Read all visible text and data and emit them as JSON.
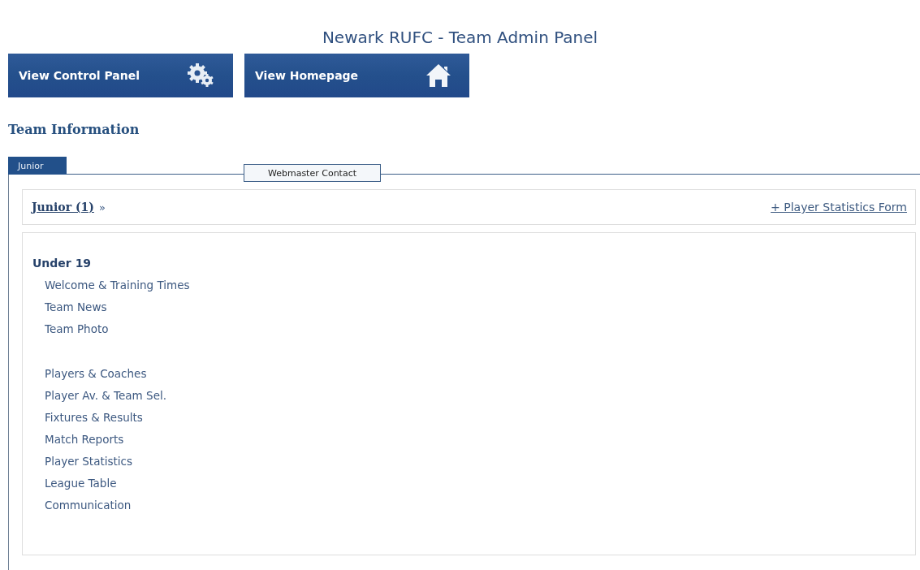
{
  "title": "Newark RUFC - Team Admin Panel",
  "buttons": [
    {
      "label": "View Control Panel",
      "kind": "settings"
    },
    {
      "label": "View Homepage",
      "kind": "home"
    }
  ],
  "section_heading": "Team Information",
  "tabs": [
    {
      "label": "Junior",
      "selected": true
    },
    {
      "label": "Webmaster Contact",
      "selected": false
    }
  ],
  "breadcrumb": {
    "link": "Junior (1)",
    "separator": "»"
  },
  "action_link": "+ Player Statistics Form",
  "team": {
    "name": "Under 19",
    "groups": [
      {
        "items": [
          "Welcome & Training Times",
          "Team News",
          "Team Photo"
        ]
      },
      {
        "items": [
          "Players & Coaches",
          "Player Av. & Team Sel.",
          "Fixtures & Results",
          "Match Reports",
          "Player Statistics",
          "League Table",
          "Communication"
        ]
      }
    ]
  }
}
